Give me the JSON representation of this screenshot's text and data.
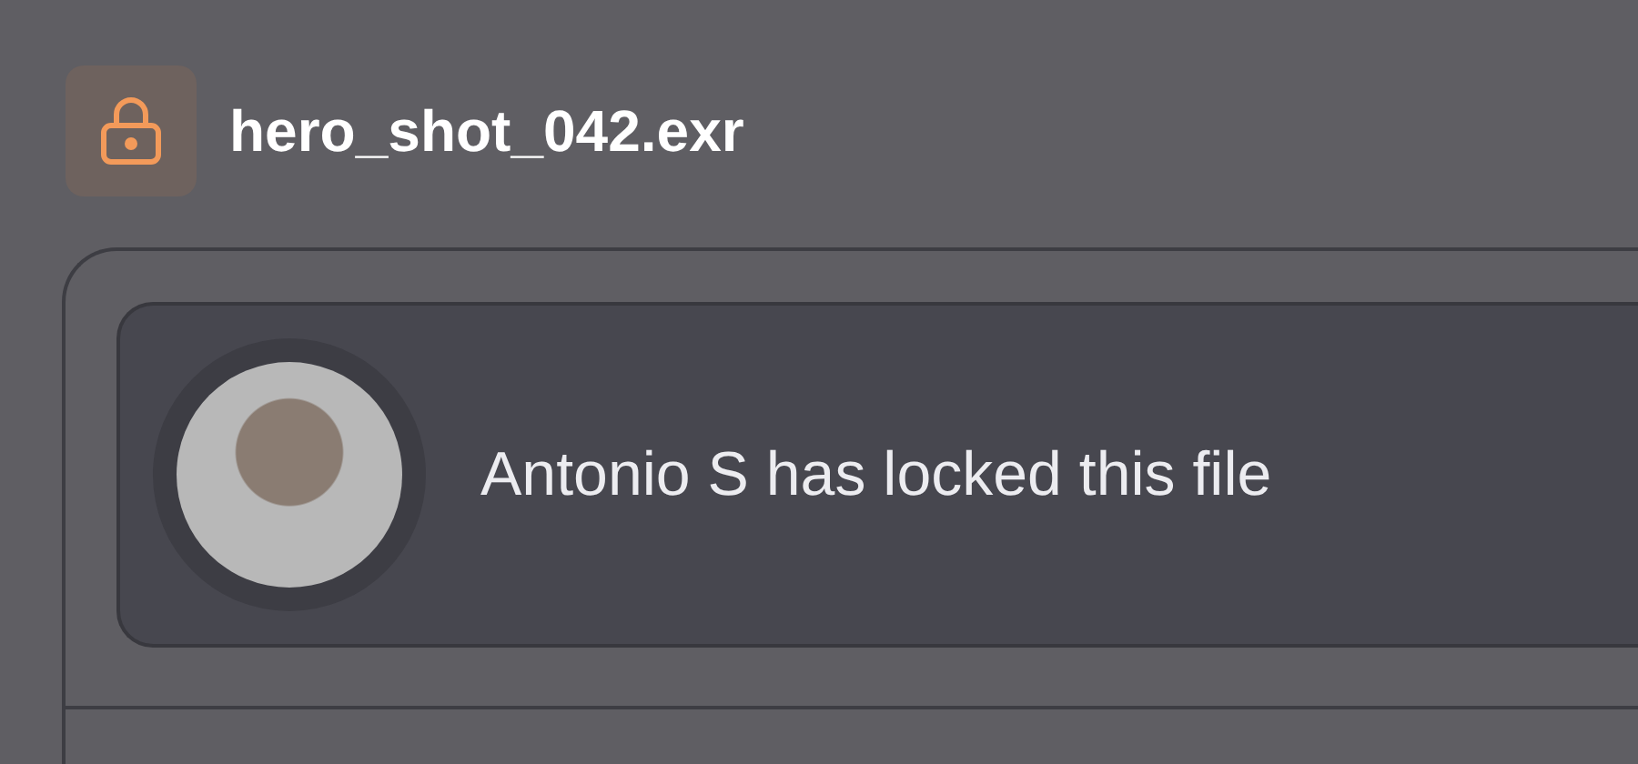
{
  "file": {
    "title": "hero_shot_042.exr"
  },
  "lock_notice": {
    "message": "Antonio S has locked this file"
  }
}
